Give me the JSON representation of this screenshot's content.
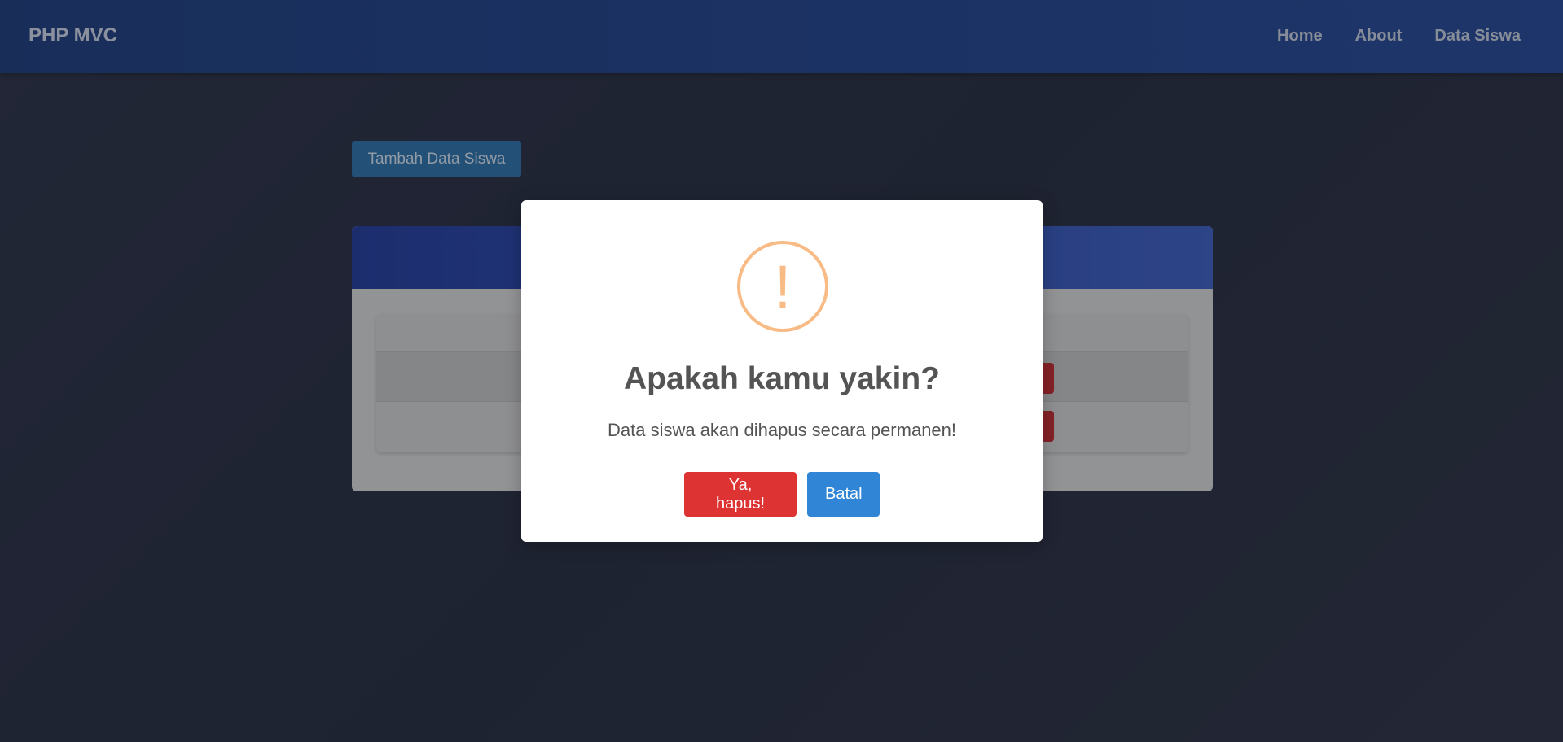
{
  "navbar": {
    "brand": "PHP MVC",
    "links": [
      "Home",
      "About",
      "Data Siswa"
    ]
  },
  "page": {
    "add_button_label": "Tambah Data Siswa"
  },
  "dialog": {
    "icon": "warning-icon",
    "icon_glyph": "!",
    "title": "Apakah kamu yakin?",
    "text": "Data siswa akan dihapus secara permanen!",
    "confirm_label": "Ya, hapus!",
    "cancel_label": "Batal"
  },
  "colors": {
    "confirm": "#dd3333",
    "cancel": "#3085d6",
    "warning": "#f8bb86",
    "navbar": "#1f4189"
  }
}
